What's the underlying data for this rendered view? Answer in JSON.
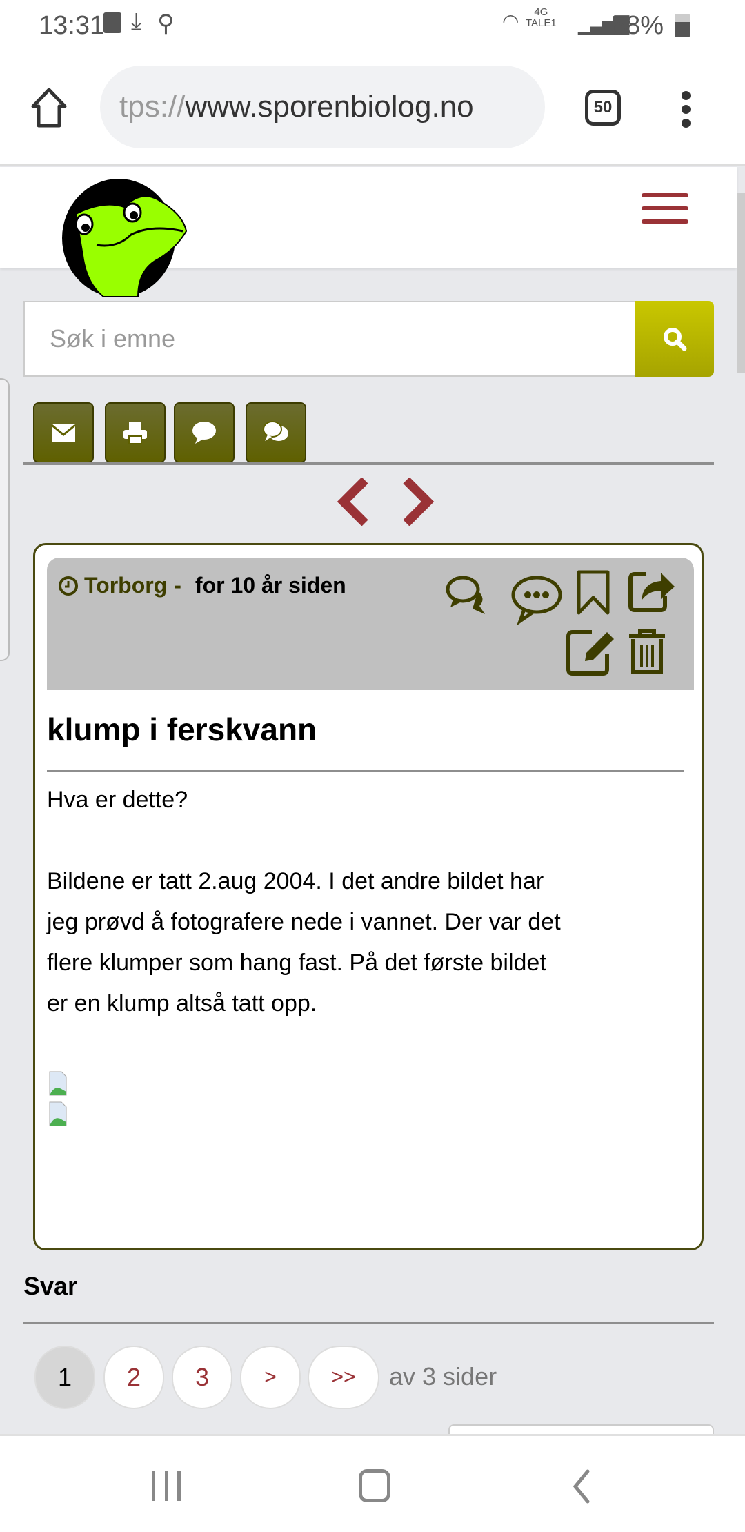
{
  "status_bar": {
    "time": "13:31",
    "network": "4G",
    "carrier": "TALE1",
    "battery": "58%"
  },
  "browser": {
    "url_prefix": "tps://",
    "url_main": "www.sporenbiolog.no",
    "tab_count": "50"
  },
  "search": {
    "placeholder": "Søk i emne"
  },
  "toolbar": {
    "icons": [
      "envelope-icon",
      "print-icon",
      "comment-icon",
      "comments-icon"
    ]
  },
  "post": {
    "author": "Torborg",
    "separator": "-",
    "time": "for 10 år siden",
    "title": "klump i ferskvann",
    "body_lines": [
      "Hva er dette?",
      "",
      "Bildene er tatt 2.aug 2004. I det andre bildet har",
      "jeg prøvd å fotografere nede i vannet. Der var det",
      "flere klumper som hang fast. På det første bildet",
      "er en klump altså tatt opp."
    ]
  },
  "answers": {
    "heading": "Svar"
  },
  "pagination": {
    "pages": [
      "1",
      "2",
      "3",
      ">",
      ">>"
    ],
    "current": "1",
    "summary": "av 3 sider"
  },
  "colors": {
    "accent": "#9a3236",
    "olive": "#5f6000",
    "search_button": "#b8b600"
  }
}
